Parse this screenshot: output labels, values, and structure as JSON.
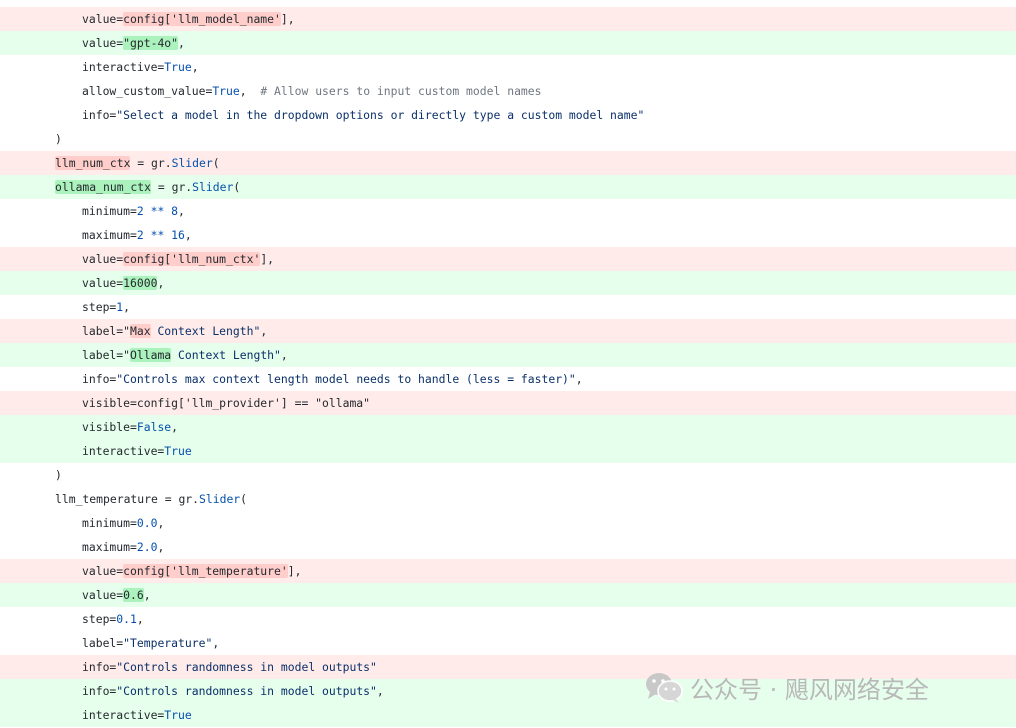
{
  "diff": {
    "lines": [
      {
        "type": "del",
        "indent": 1,
        "segments": [
          [
            "k",
            "value="
          ],
          [
            "hl-del",
            "config['llm_model_name'"
          ],
          [
            "k",
            "],"
          ]
        ]
      },
      {
        "type": "add",
        "indent": 1,
        "segments": [
          [
            "k",
            "value="
          ],
          [
            "hl-add",
            "\"gpt-4o\""
          ],
          [
            "k",
            ","
          ]
        ]
      },
      {
        "type": "ctx",
        "indent": 1,
        "segments": [
          [
            "k",
            "interactive="
          ],
          [
            "v",
            "True"
          ],
          [
            "k",
            ","
          ]
        ]
      },
      {
        "type": "ctx",
        "indent": 1,
        "segments": [
          [
            "k",
            "allow_custom_value="
          ],
          [
            "v",
            "True"
          ],
          [
            "k",
            ",  "
          ],
          [
            "c",
            "# Allow users to input custom model names"
          ]
        ]
      },
      {
        "type": "ctx",
        "indent": 1,
        "segments": [
          [
            "k",
            "info="
          ],
          [
            "s",
            "\"Select a model in the dropdown options or directly type a custom model name\""
          ]
        ]
      },
      {
        "type": "ctx",
        "indent": 0,
        "segments": [
          [
            "k",
            ")"
          ]
        ]
      },
      {
        "type": "del",
        "indent": 0,
        "segments": [
          [
            "hl-del",
            "llm_num_ctx"
          ],
          [
            "k",
            " = gr."
          ],
          [
            "v",
            "Slider"
          ],
          [
            "k",
            "("
          ]
        ]
      },
      {
        "type": "add",
        "indent": 0,
        "segments": [
          [
            "hl-add",
            "ollama_num_ctx"
          ],
          [
            "k",
            " = gr."
          ],
          [
            "v",
            "Slider"
          ],
          [
            "k",
            "("
          ]
        ]
      },
      {
        "type": "ctx",
        "indent": 1,
        "segments": [
          [
            "k",
            "minimum="
          ],
          [
            "v",
            "2 ** 8"
          ],
          [
            "k",
            ","
          ]
        ]
      },
      {
        "type": "ctx",
        "indent": 1,
        "segments": [
          [
            "k",
            "maximum="
          ],
          [
            "v",
            "2 ** 16"
          ],
          [
            "k",
            ","
          ]
        ]
      },
      {
        "type": "del",
        "indent": 1,
        "segments": [
          [
            "k",
            "value="
          ],
          [
            "hl-del",
            "config['llm_num_ctx'"
          ],
          [
            "k",
            "],"
          ]
        ]
      },
      {
        "type": "add",
        "indent": 1,
        "segments": [
          [
            "k",
            "value="
          ],
          [
            "hl-add",
            "16000"
          ],
          [
            "k",
            ","
          ]
        ]
      },
      {
        "type": "ctx",
        "indent": 1,
        "segments": [
          [
            "k",
            "step="
          ],
          [
            "v",
            "1"
          ],
          [
            "k",
            ","
          ]
        ]
      },
      {
        "type": "del",
        "indent": 1,
        "segments": [
          [
            "k",
            "label=\""
          ],
          [
            "hl-del",
            "Max"
          ],
          [
            "s",
            " Context Length\""
          ],
          [
            "k",
            ","
          ]
        ]
      },
      {
        "type": "add",
        "indent": 1,
        "segments": [
          [
            "k",
            "label=\""
          ],
          [
            "hl-add",
            "Ollama"
          ],
          [
            "s",
            " Context Length\""
          ],
          [
            "k",
            ","
          ]
        ]
      },
      {
        "type": "ctx",
        "indent": 1,
        "segments": [
          [
            "k",
            "info="
          ],
          [
            "s",
            "\"Controls max context length model needs to handle (less = faster)\""
          ],
          [
            "k",
            ","
          ]
        ]
      },
      {
        "type": "del",
        "indent": 1,
        "segments": [
          [
            "k",
            "visible=config['llm_provider'] == \"ollama\""
          ]
        ]
      },
      {
        "type": "add",
        "indent": 1,
        "segments": [
          [
            "k",
            "visible="
          ],
          [
            "v",
            "False"
          ],
          [
            "k",
            ","
          ]
        ]
      },
      {
        "type": "add",
        "indent": 1,
        "segments": [
          [
            "k",
            "interactive="
          ],
          [
            "v",
            "True"
          ]
        ]
      },
      {
        "type": "ctx",
        "indent": 0,
        "segments": [
          [
            "k",
            ")"
          ]
        ]
      },
      {
        "type": "ctx",
        "indent": 0,
        "segments": [
          [
            "k",
            "llm_temperature = gr."
          ],
          [
            "v",
            "Slider"
          ],
          [
            "k",
            "("
          ]
        ]
      },
      {
        "type": "ctx",
        "indent": 1,
        "segments": [
          [
            "k",
            "minimum="
          ],
          [
            "v",
            "0.0"
          ],
          [
            "k",
            ","
          ]
        ]
      },
      {
        "type": "ctx",
        "indent": 1,
        "segments": [
          [
            "k",
            "maximum="
          ],
          [
            "v",
            "2.0"
          ],
          [
            "k",
            ","
          ]
        ]
      },
      {
        "type": "del",
        "indent": 1,
        "segments": [
          [
            "k",
            "value="
          ],
          [
            "hl-del",
            "config['llm_temperature'"
          ],
          [
            "k",
            "],"
          ]
        ]
      },
      {
        "type": "add",
        "indent": 1,
        "segments": [
          [
            "k",
            "value="
          ],
          [
            "hl-add",
            "0.6"
          ],
          [
            "k",
            ","
          ]
        ]
      },
      {
        "type": "ctx",
        "indent": 1,
        "segments": [
          [
            "k",
            "step="
          ],
          [
            "v",
            "0.1"
          ],
          [
            "k",
            ","
          ]
        ]
      },
      {
        "type": "ctx",
        "indent": 1,
        "segments": [
          [
            "k",
            "label="
          ],
          [
            "s",
            "\"Temperature\""
          ],
          [
            "k",
            ","
          ]
        ]
      },
      {
        "type": "del",
        "indent": 1,
        "segments": [
          [
            "k",
            "info="
          ],
          [
            "s",
            "\"Controls randomness in model outputs\""
          ]
        ]
      },
      {
        "type": "add",
        "indent": 1,
        "segments": [
          [
            "k",
            "info="
          ],
          [
            "s",
            "\"Controls randomness in model outputs\""
          ],
          [
            "k",
            ","
          ]
        ]
      },
      {
        "type": "add",
        "indent": 1,
        "segments": [
          [
            "k",
            "interactive="
          ],
          [
            "v",
            "True"
          ]
        ]
      }
    ]
  },
  "watermark": {
    "icon": "wechat-icon",
    "text": "公众号 · 飓风网络安全",
    "color": "#b8b8b8"
  },
  "colors": {
    "del_bg": "#ffebe9",
    "add_bg": "#e6ffec",
    "del_highlight": "#ffcecb",
    "add_highlight": "#abf2bc",
    "keyword_blue": "#0550ae"
  }
}
